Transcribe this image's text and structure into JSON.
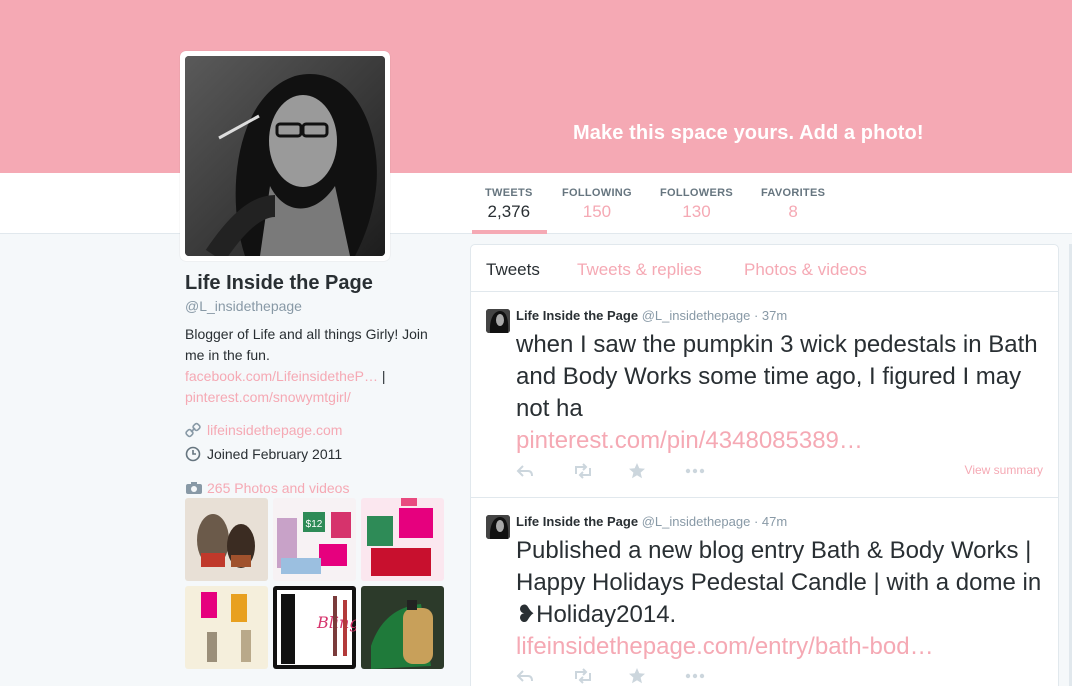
{
  "banner": {
    "cta": "Make this space yours. Add a photo!"
  },
  "stats": [
    {
      "label": "TWEETS",
      "value": "2,376"
    },
    {
      "label": "FOLLOWING",
      "value": "150"
    },
    {
      "label": "FOLLOWERS",
      "value": "130"
    },
    {
      "label": "FAVORITES",
      "value": "8"
    }
  ],
  "profile": {
    "name": "Life Inside the Page",
    "handle": "@L_insidethepage",
    "bio": "Blogger of Life and all things Girly! Join me in the fun.",
    "bio_link_facebook": "facebook.com/LifeinsidetheP…",
    "bio_separator": " |",
    "bio_link_pinterest": "pinterest.com/snowymtgirl/",
    "website": "lifeinsidethepage.com",
    "joined": "Joined February 2011",
    "photos_label": "265 Photos and videos"
  },
  "thumbnails": [
    "candle-jars",
    "sale-coupons",
    "three-free-offer",
    "perfume-bottles",
    "victorias-secret-bling",
    "philosophy-bottle"
  ],
  "tabs": [
    "Tweets",
    "Tweets & replies",
    "Photos & videos"
  ],
  "tweets": [
    {
      "name": "Life Inside the Page",
      "handle": "@L_insidethepage",
      "time": "· 37m",
      "text": "when I saw the pumpkin 3 wick pedestals in Bath and Body Works some time ago, I figured I may not ha",
      "link": "pinterest.com/pin/4348085389…",
      "summary": "View summary"
    },
    {
      "name": "Life Inside the Page",
      "handle": "@L_insidethepage",
      "time": "· 47m",
      "text": "Published a new blog entry Bath & Body Works | Happy Holidays Pedestal Candle | with a dome in ❥Holiday2014.",
      "link": "lifeinsidethepage.com/entry/bath-bod…"
    }
  ],
  "colors": {
    "accent": "#f5a9b4",
    "text": "#292f33",
    "muted": "#8899a6"
  }
}
